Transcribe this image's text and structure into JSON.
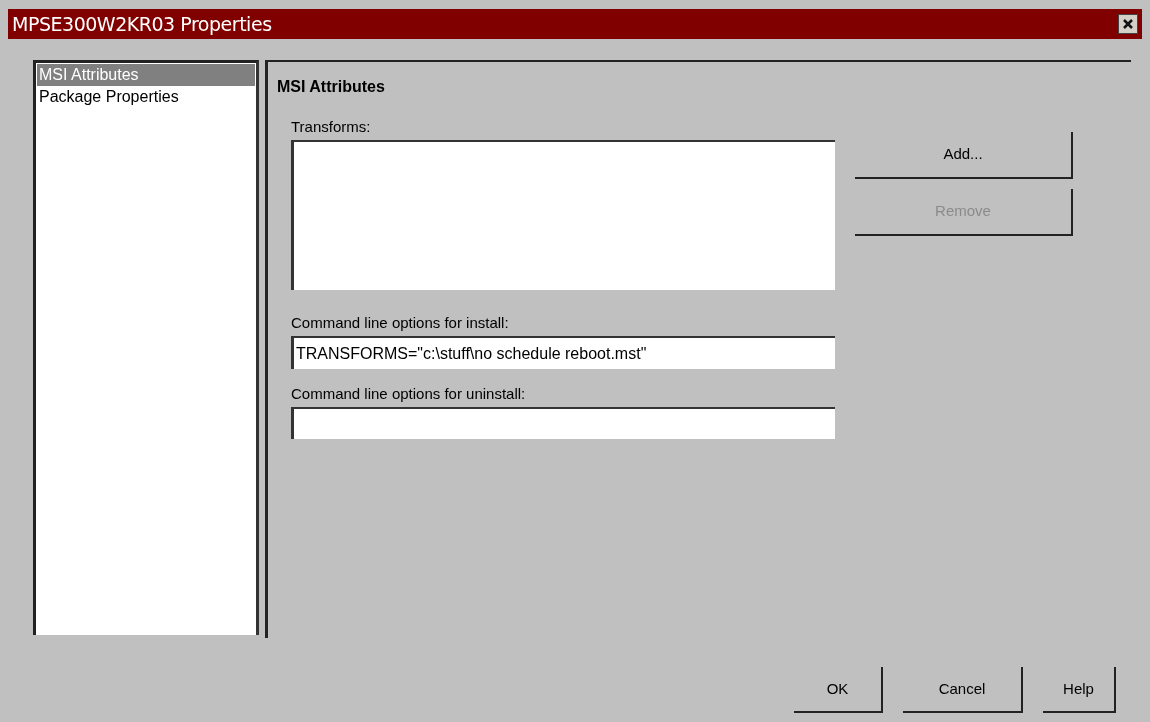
{
  "window": {
    "title": "MPSE300W2KR03 Properties"
  },
  "sidebar": {
    "items": [
      {
        "label": "MSI Attributes",
        "selected": true
      },
      {
        "label": "Package Properties",
        "selected": false
      }
    ]
  },
  "panel": {
    "heading": "MSI Attributes",
    "transforms": {
      "label": "Transforms:"
    },
    "install": {
      "label": "Command line options for install:",
      "value": "TRANSFORMS=\"c:\\stuff\\no schedule reboot.mst\""
    },
    "uninstall": {
      "label": "Command line options for uninstall:"
    },
    "side_buttons": [
      {
        "label": "Add...",
        "disabled": false
      },
      {
        "label": "Remove",
        "disabled": true
      }
    ]
  },
  "buttons": [
    {
      "label": "OK"
    },
    {
      "label": "Cancel"
    },
    {
      "label": "Help"
    }
  ]
}
